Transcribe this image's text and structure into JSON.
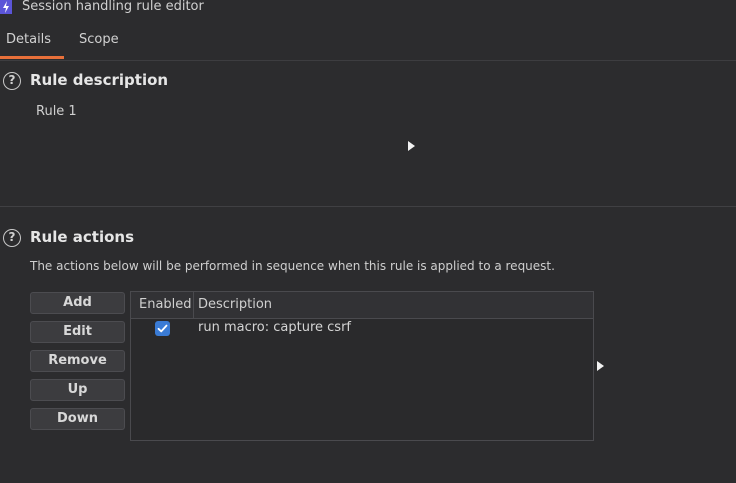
{
  "window": {
    "title": "Session handling rule editor"
  },
  "tabs": [
    {
      "label": "Details",
      "active": true
    },
    {
      "label": "Scope",
      "active": false
    }
  ],
  "rule_description": {
    "title": "Rule description",
    "value": "Rule 1"
  },
  "rule_actions": {
    "title": "Rule actions",
    "description": "The actions below will be performed in sequence when this rule is applied to a request.",
    "buttons": {
      "add": "Add",
      "edit": "Edit",
      "remove": "Remove",
      "up": "Up",
      "down": "Down"
    },
    "table": {
      "columns": [
        "Enabled",
        "Description"
      ],
      "rows": [
        {
          "enabled": true,
          "description": "run macro: capture csrf"
        }
      ]
    }
  },
  "colors": {
    "accent_tab": "#e8703a",
    "checkbox": "#3a7bd5",
    "app_icon": "#5b55d8"
  }
}
